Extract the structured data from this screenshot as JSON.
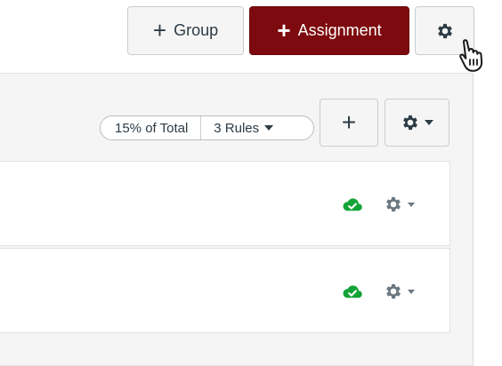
{
  "header": {
    "group_button": {
      "label": "Group",
      "icon": "plus-icon"
    },
    "assignment_button": {
      "label": "Assignment",
      "icon": "plus-icon"
    },
    "settings_button": {
      "icon": "gear-icon"
    }
  },
  "assignment_group": {
    "weight_label": "15% of Total",
    "rules_label": "3 Rules",
    "add_button_icon": "plus-icon",
    "settings_icon": "gear-icon"
  },
  "assignments": [
    {
      "status": "published",
      "status_icon": "cloud-check-icon",
      "menu_icon": "gear-icon"
    },
    {
      "status": "published",
      "status_icon": "cloud-check-icon",
      "menu_icon": "gear-icon"
    }
  ],
  "colors": {
    "primary": "#7d0a0e",
    "published": "#13a337",
    "icon": "#2d3b45",
    "icon_muted": "#6b7780",
    "panel_bg": "#f5f5f5"
  }
}
